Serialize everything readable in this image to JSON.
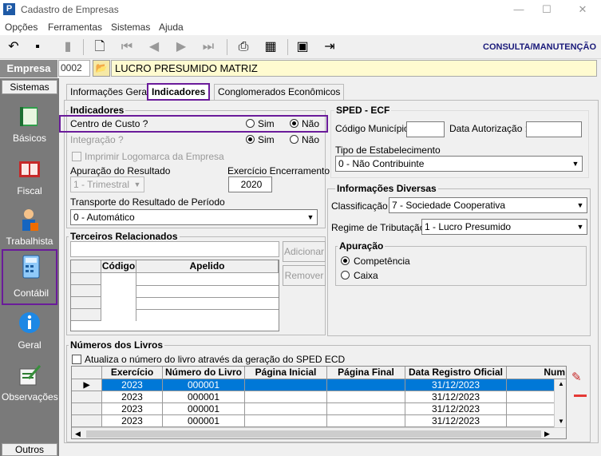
{
  "window": {
    "title": "Cadastro de Empresas",
    "minimize": "—",
    "maximize": "☐",
    "close": "✕"
  },
  "menu": [
    "Opções",
    "Ferramentas",
    "Sistemas",
    "Ajuda"
  ],
  "toolbar": {
    "mode_title": "CONSULTA/MANUTENÇÃO"
  },
  "empresa": {
    "label": "Empresa",
    "code": "0002",
    "name": "LUCRO PRESUMIDO MATRIZ"
  },
  "sidebar": {
    "top_label": "Sistemas",
    "items": [
      {
        "label": "Básicos",
        "icon": "book-icon"
      },
      {
        "label": "Fiscal",
        "icon": "fiscal-book-icon"
      },
      {
        "label": "Trabalhista",
        "icon": "worker-icon"
      },
      {
        "label": "Contábil",
        "icon": "calculator-icon"
      },
      {
        "label": "Geral",
        "icon": "info-icon"
      },
      {
        "label": "Observações",
        "icon": "notepad-icon"
      }
    ],
    "bottom_label": "Outros"
  },
  "tabs": [
    "Informações Gerais",
    "Indicadores",
    "Conglomerados Econômicos"
  ],
  "indicadores": {
    "title": "Indicadores",
    "centro_custo": {
      "label": "Centro de Custo ?",
      "sim": "Sim",
      "nao": "Não",
      "selected": "nao"
    },
    "integracao": {
      "label": "Integração ?",
      "sim": "Sim",
      "nao": "Não",
      "selected": "sim"
    },
    "imprimir_logo": "Imprimir Logomarca da Empresa",
    "apuracao_label": "Apuração do Resultado",
    "apuracao_value": "1 - Trimestral",
    "exercicio_label": "Exercício Encerramento",
    "exercicio_value": "2020",
    "transporte_label": "Transporte do Resultado de Período",
    "transporte_value": "0 - Automático"
  },
  "sped": {
    "title": "SPED - ECF",
    "codigo_municipio": "Código Município :",
    "data_autorizacao": "Data Autorização :",
    "tipo_label": "Tipo de Estabelecimento",
    "tipo_value": "0 - Não Contribuinte"
  },
  "diversas": {
    "title": "Informações Diversas",
    "classificacao_label": "Classificação :",
    "classificacao_value": "7 - Sociedade Cooperativa",
    "regime_label": "Regime de Tributação :",
    "regime_value": "1 - Lucro Presumido",
    "apuracao_title": "Apuração",
    "competencia": "Competência",
    "caixa": "Caixa"
  },
  "terceiros": {
    "title": "Terceiros Relacionados",
    "adicionar": "Adicionar",
    "remover": "Remover",
    "columns": [
      "Código",
      "Apelido"
    ]
  },
  "livros": {
    "title": "Números dos Livros",
    "checkbox": "Atualiza o número do livro através da geração do SPED ECD",
    "columns": [
      "Exercício",
      "Número do Livro",
      "Página Inicial",
      "Página Final",
      "Data Registro Oficial",
      "Num"
    ],
    "rows": [
      [
        "2023",
        "000001",
        "",
        "",
        "31/12/2023"
      ],
      [
        "2023",
        "000001",
        "",
        "",
        "31/12/2023"
      ],
      [
        "2023",
        "000001",
        "",
        "",
        "31/12/2023"
      ],
      [
        "2023",
        "000001",
        "",
        "",
        "31/12/2023"
      ]
    ]
  }
}
